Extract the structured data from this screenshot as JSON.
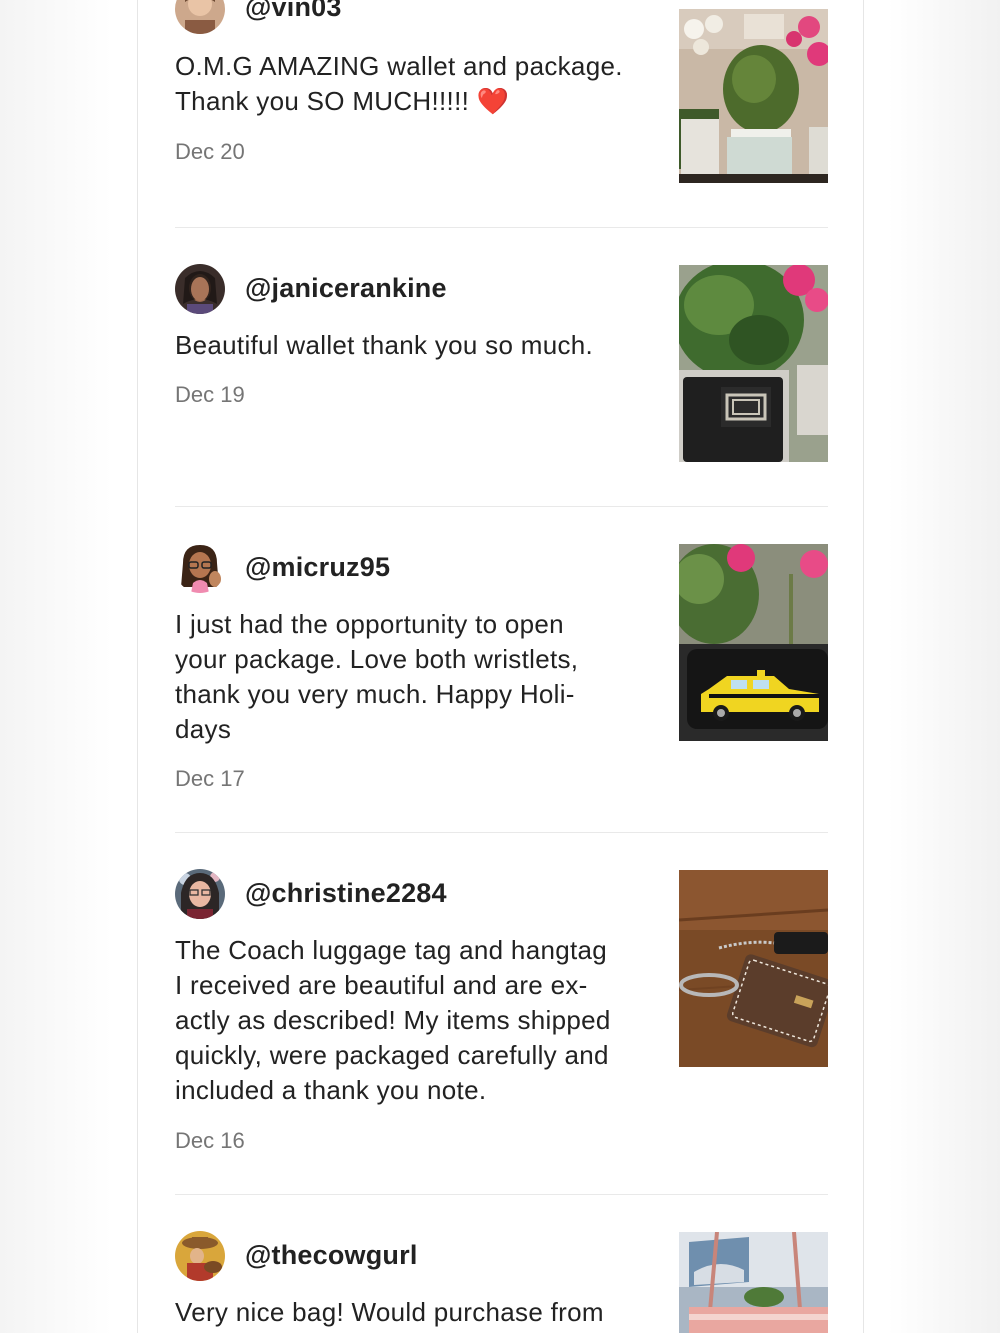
{
  "reviews": [
    {
      "username": "@vin03",
      "lines": [
        "O.M.G AMAZING wallet and package.",
        "Thank you SO MUCH!!!!! ❤️"
      ],
      "date": "Dec 20",
      "photo": "wallet-with-plants-photo"
    },
    {
      "username": "@janicerankine",
      "lines": [
        "Beautiful wallet thank you so much."
      ],
      "date": "Dec 19",
      "photo": "black-wallet-photo"
    },
    {
      "username": "@micruz95",
      "lines": [
        "I just had the opportunity to open",
        "your package. Love both wristlets,",
        "thank you very much. Happy Holi-",
        "days"
      ],
      "date": "Dec 17",
      "photo": "taxi-wristlet-photo"
    },
    {
      "username": "@christine2284",
      "lines": [
        "The Coach luggage tag and hangtag",
        "I received are beautiful and are ex-",
        "actly as described! My items shipped",
        "quickly, were packaged carefully and",
        "included a thank you note."
      ],
      "date": "Dec 16",
      "photo": "luggage-tag-photo"
    },
    {
      "username": "@thecowgurl",
      "lines": [
        "Very nice bag! Would purchase from"
      ],
      "date": "",
      "photo": "tote-bag-photo"
    }
  ],
  "colors": {
    "text": "#222222",
    "date": "#757575",
    "divider": "#e9e9e9",
    "heart": "#d0161b"
  }
}
